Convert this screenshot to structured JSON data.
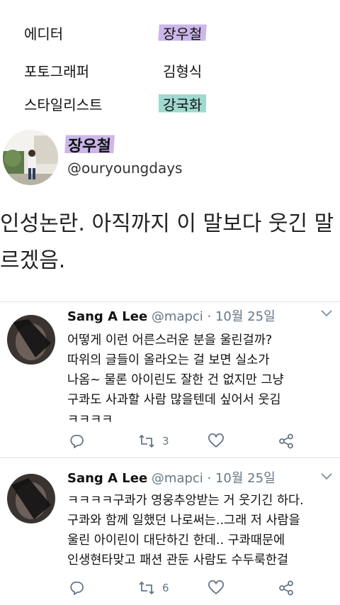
{
  "credits": [
    {
      "role": "에디터",
      "name": "장우철",
      "highlight": "#cbb7ea"
    },
    {
      "role": "포토그래퍼",
      "name": "김형식",
      "highlight": ""
    },
    {
      "role": "스타일리스트",
      "name": "강국화",
      "highlight": "#9fd9cf"
    }
  ],
  "profile": {
    "display_name": "장우철",
    "handle": "@ouryoungdays"
  },
  "tweet": {
    "lines": [
      "인성논란. 아직까지 이 말보다 웃긴 말",
      "르겠음."
    ]
  },
  "replies": [
    {
      "name": "Sang A Lee",
      "handle": "@mapci",
      "date": "· 10월 25일",
      "lines": [
        "어떻게 이런 어른스러운 분을 울린걸까?",
        "따위의 글들이 올라오는 걸 보면 실소가",
        "나옴~ 물론 아이린도 잘한 건 없지만 그냥",
        "구콰도 사과할 사람 많을텐데 싶어서 웃김",
        "ㅋㅋㅋㅋ"
      ],
      "retweets": "3"
    },
    {
      "name": "Sang A Lee",
      "handle": "@mapci",
      "date": "· 10월 25일",
      "lines": [
        "ㅋㅋㅋㅋ구콰가 영웅추앙받는 거 웃기긴 하다.",
        "구콰와 함께 일했던 나로써는..그래 저 사람을",
        "울린 아이린이 대단하긴 한데.. 구콰때문에",
        "인생현타맞고 패션 관둔 사람도 수두룩한걸"
      ],
      "retweets": "6"
    }
  ],
  "colors": {
    "meta": "#657786",
    "divider": "#dde2e6",
    "highlight_purple": "#cbb7ea",
    "highlight_teal": "#9fd9cf"
  }
}
